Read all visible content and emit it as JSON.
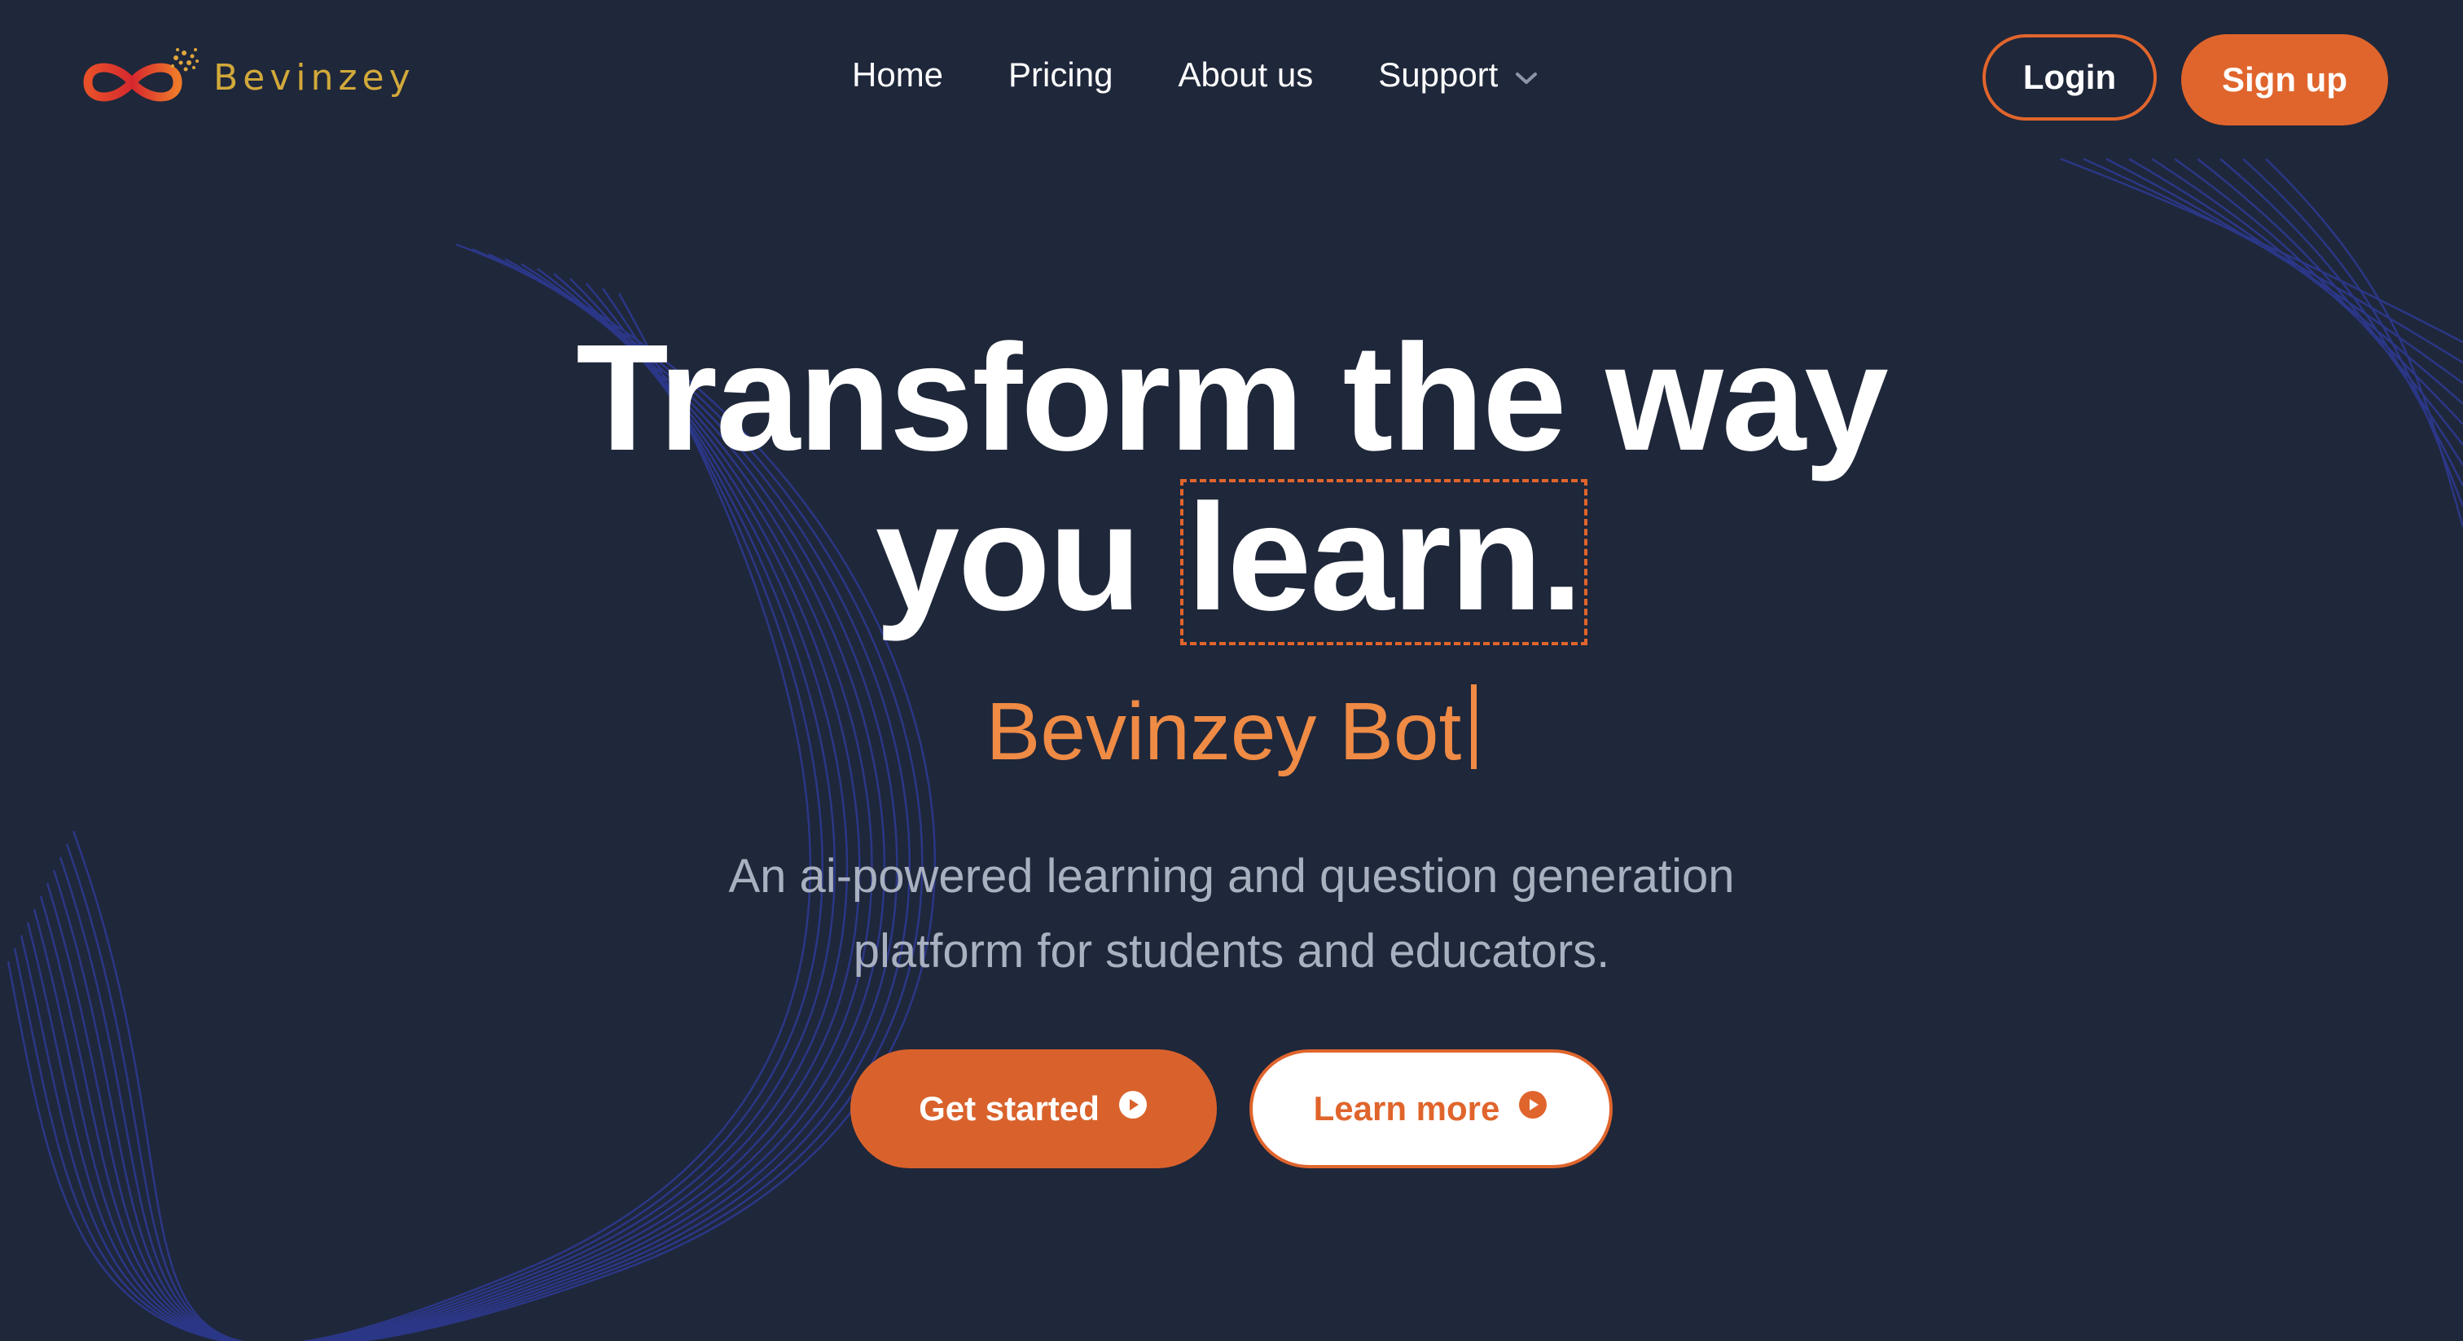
{
  "brand": {
    "name": "Bevinzey",
    "logo_icon": "infinity-logo-icon",
    "accent": "#e0652c",
    "gold": "#d2a93a"
  },
  "nav": {
    "items": [
      {
        "label": "Home"
      },
      {
        "label": "Pricing"
      },
      {
        "label": "About us"
      },
      {
        "label": "Support"
      }
    ],
    "support_icon": "chevron-down-icon",
    "login_label": "Login",
    "signup_label": "Sign up"
  },
  "hero": {
    "line1": "Transform the way",
    "line2_prefix": "you",
    "line2_highlight": "learn.",
    "typed_text": "Bevinzey Bot",
    "description_line1": "An ai-powered learning and question generation",
    "description_line2": "platform for students and educators.",
    "get_started_label": "Get started",
    "learn_more_label": "Learn more",
    "button_icon": "play-circle-icon"
  },
  "colors": {
    "background": "#1f273a",
    "typed_text": "#ef8b45",
    "description": "#a9b0bf"
  }
}
